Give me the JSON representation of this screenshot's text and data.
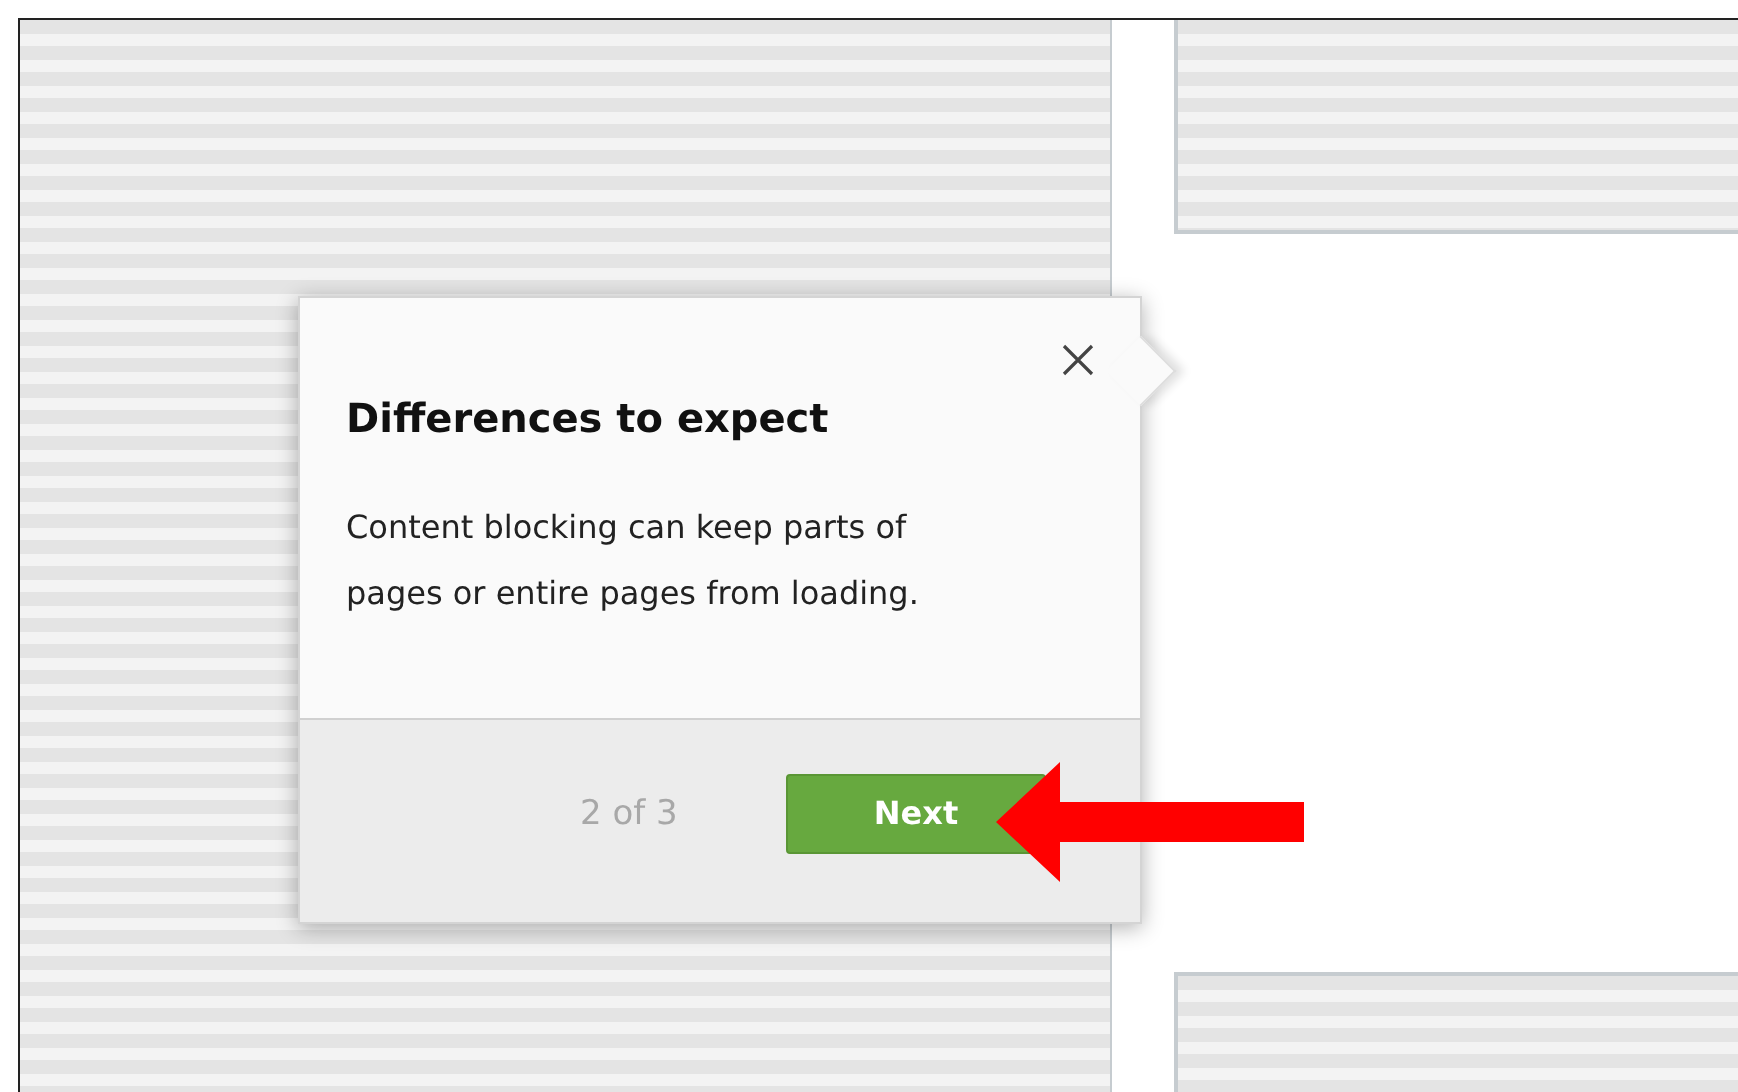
{
  "popup": {
    "title": "Differences to expect",
    "body": "Content blocking can keep parts of pages or entire pages from loading.",
    "progress": "2 of 3",
    "next_button": "Next"
  }
}
